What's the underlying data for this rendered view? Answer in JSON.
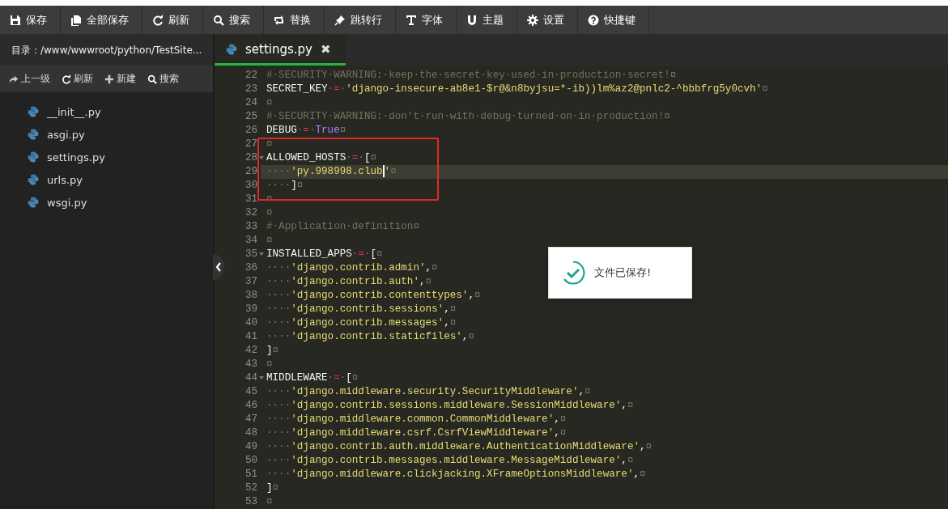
{
  "toolbar": [
    {
      "label": "保存"
    },
    {
      "label": "全部保存"
    },
    {
      "label": "刷新"
    },
    {
      "label": "搜索"
    },
    {
      "label": "替换"
    },
    {
      "label": "跳转行"
    },
    {
      "label": "字体"
    },
    {
      "label": "主题"
    },
    {
      "label": "设置"
    },
    {
      "label": "快捷键"
    }
  ],
  "sidebar": {
    "path": "目录：/www/wwwroot/python/TestSite...",
    "actions": [
      {
        "label": "上一级"
      },
      {
        "label": "刷新"
      },
      {
        "label": "新建"
      },
      {
        "label": "搜索"
      }
    ],
    "files": [
      {
        "name": "__init__.py"
      },
      {
        "name": "asgi.py"
      },
      {
        "name": "settings.py"
      },
      {
        "name": "urls.py"
      },
      {
        "name": "wsgi.py"
      }
    ]
  },
  "tabs": [
    {
      "label": "settings.py",
      "selected": true,
      "close": "✖"
    }
  ],
  "editor": {
    "lines": [
      {
        "number": "22",
        "foldable": false,
        "current": false,
        "tokens": [
          {
            "kind": "cm",
            "text": "#·SECURITY·WARNING:·keep·the·secret·key·used·in·production·secret!"
          },
          {
            "kind": "ws",
            "text": "¤"
          }
        ]
      },
      {
        "number": "23",
        "foldable": false,
        "current": false,
        "tokens": [
          {
            "kind": "nm",
            "text": "SECRET_KEY"
          },
          {
            "kind": "ws",
            "text": "·"
          },
          {
            "kind": "op",
            "text": "="
          },
          {
            "kind": "ws",
            "text": "·"
          },
          {
            "kind": "st",
            "text": "'django-insecure-ab8e1-$r@&n8byjsu=*-ib))lm%az2@pnlc2-^bbbfrg5y0cvh'"
          },
          {
            "kind": "ws",
            "text": "¤"
          }
        ]
      },
      {
        "number": "24",
        "foldable": false,
        "current": false,
        "tokens": [
          {
            "kind": "ws",
            "text": "¤"
          }
        ]
      },
      {
        "number": "25",
        "foldable": false,
        "current": false,
        "tokens": [
          {
            "kind": "cm",
            "text": "#·SECURITY·WARNING:·don't·run·with·debug·turned·on·in·production!"
          },
          {
            "kind": "ws",
            "text": "¤"
          }
        ]
      },
      {
        "number": "26",
        "foldable": false,
        "current": false,
        "tokens": [
          {
            "kind": "nm",
            "text": "DEBUG"
          },
          {
            "kind": "ws",
            "text": "·"
          },
          {
            "kind": "op",
            "text": "="
          },
          {
            "kind": "ws",
            "text": "·"
          },
          {
            "kind": "kw",
            "text": "True"
          },
          {
            "kind": "ws",
            "text": "¤"
          }
        ]
      },
      {
        "number": "27",
        "foldable": false,
        "current": false,
        "tokens": [
          {
            "kind": "ws",
            "text": "¤"
          }
        ]
      },
      {
        "number": "28",
        "foldable": true,
        "current": false,
        "tokens": [
          {
            "kind": "nm",
            "text": "ALLOWED_HOSTS"
          },
          {
            "kind": "ws",
            "text": "·"
          },
          {
            "kind": "op",
            "text": "="
          },
          {
            "kind": "ws",
            "text": "·"
          },
          {
            "kind": "nm",
            "text": "["
          },
          {
            "kind": "ws",
            "text": "¤"
          }
        ]
      },
      {
        "number": "29",
        "foldable": false,
        "current": true,
        "tokens": [
          {
            "kind": "ws",
            "text": "····"
          },
          {
            "kind": "st",
            "text": "'py.998998.club",
            "cursor_after": true
          },
          {
            "kind": "st",
            "text": "'"
          },
          {
            "kind": "ws",
            "text": "¤"
          }
        ]
      },
      {
        "number": "30",
        "foldable": false,
        "current": false,
        "tokens": [
          {
            "kind": "ws",
            "text": "····"
          },
          {
            "kind": "nm",
            "text": "]"
          },
          {
            "kind": "ws",
            "text": "¤"
          }
        ]
      },
      {
        "number": "31",
        "foldable": false,
        "current": false,
        "tokens": [
          {
            "kind": "ws",
            "text": "¤"
          }
        ]
      },
      {
        "number": "32",
        "foldable": false,
        "current": false,
        "tokens": [
          {
            "kind": "ws",
            "text": "¤"
          }
        ]
      },
      {
        "number": "33",
        "foldable": false,
        "current": false,
        "tokens": [
          {
            "kind": "cm",
            "text": "#·Application·definition"
          },
          {
            "kind": "ws",
            "text": "¤"
          }
        ]
      },
      {
        "number": "34",
        "foldable": false,
        "current": false,
        "tokens": [
          {
            "kind": "ws",
            "text": "¤"
          }
        ]
      },
      {
        "number": "35",
        "foldable": true,
        "current": false,
        "tokens": [
          {
            "kind": "nm",
            "text": "INSTALLED_APPS"
          },
          {
            "kind": "ws",
            "text": "·"
          },
          {
            "kind": "op",
            "text": "="
          },
          {
            "kind": "ws",
            "text": "·"
          },
          {
            "kind": "nm",
            "text": "["
          },
          {
            "kind": "ws",
            "text": "¤"
          }
        ]
      },
      {
        "number": "36",
        "foldable": false,
        "current": false,
        "tokens": [
          {
            "kind": "ws",
            "text": "····"
          },
          {
            "kind": "st",
            "text": "'django.contrib.admin'"
          },
          {
            "kind": "nm",
            "text": ","
          },
          {
            "kind": "ws",
            "text": "¤"
          }
        ]
      },
      {
        "number": "37",
        "foldable": false,
        "current": false,
        "tokens": [
          {
            "kind": "ws",
            "text": "····"
          },
          {
            "kind": "st",
            "text": "'django.contrib.auth'"
          },
          {
            "kind": "nm",
            "text": ","
          },
          {
            "kind": "ws",
            "text": "¤"
          }
        ]
      },
      {
        "number": "38",
        "foldable": false,
        "current": false,
        "tokens": [
          {
            "kind": "ws",
            "text": "····"
          },
          {
            "kind": "st",
            "text": "'django.contrib.contenttypes'"
          },
          {
            "kind": "nm",
            "text": ","
          },
          {
            "kind": "ws",
            "text": "¤"
          }
        ]
      },
      {
        "number": "39",
        "foldable": false,
        "current": false,
        "tokens": [
          {
            "kind": "ws",
            "text": "····"
          },
          {
            "kind": "st",
            "text": "'django.contrib.sessions'"
          },
          {
            "kind": "nm",
            "text": ","
          },
          {
            "kind": "ws",
            "text": "¤"
          }
        ]
      },
      {
        "number": "40",
        "foldable": false,
        "current": false,
        "tokens": [
          {
            "kind": "ws",
            "text": "····"
          },
          {
            "kind": "st",
            "text": "'django.contrib.messages'"
          },
          {
            "kind": "nm",
            "text": ","
          },
          {
            "kind": "ws",
            "text": "¤"
          }
        ]
      },
      {
        "number": "41",
        "foldable": false,
        "current": false,
        "tokens": [
          {
            "kind": "ws",
            "text": "····"
          },
          {
            "kind": "st",
            "text": "'django.contrib.staticfiles'"
          },
          {
            "kind": "nm",
            "text": ","
          },
          {
            "kind": "ws",
            "text": "¤"
          }
        ]
      },
      {
        "number": "42",
        "foldable": false,
        "current": false,
        "tokens": [
          {
            "kind": "nm",
            "text": "]"
          },
          {
            "kind": "ws",
            "text": "¤"
          }
        ]
      },
      {
        "number": "43",
        "foldable": false,
        "current": false,
        "tokens": [
          {
            "kind": "ws",
            "text": "¤"
          }
        ]
      },
      {
        "number": "44",
        "foldable": true,
        "current": false,
        "tokens": [
          {
            "kind": "nm",
            "text": "MIDDLEWARE"
          },
          {
            "kind": "ws",
            "text": "·"
          },
          {
            "kind": "op",
            "text": "="
          },
          {
            "kind": "ws",
            "text": "·"
          },
          {
            "kind": "nm",
            "text": "["
          },
          {
            "kind": "ws",
            "text": "¤"
          }
        ]
      },
      {
        "number": "45",
        "foldable": false,
        "current": false,
        "tokens": [
          {
            "kind": "ws",
            "text": "····"
          },
          {
            "kind": "st",
            "text": "'django.middleware.security.SecurityMiddleware'"
          },
          {
            "kind": "nm",
            "text": ","
          },
          {
            "kind": "ws",
            "text": "¤"
          }
        ]
      },
      {
        "number": "46",
        "foldable": false,
        "current": false,
        "tokens": [
          {
            "kind": "ws",
            "text": "····"
          },
          {
            "kind": "st",
            "text": "'django.contrib.sessions.middleware.SessionMiddleware'"
          },
          {
            "kind": "nm",
            "text": ","
          },
          {
            "kind": "ws",
            "text": "¤"
          }
        ]
      },
      {
        "number": "47",
        "foldable": false,
        "current": false,
        "tokens": [
          {
            "kind": "ws",
            "text": "····"
          },
          {
            "kind": "st",
            "text": "'django.middleware.common.CommonMiddleware'"
          },
          {
            "kind": "nm",
            "text": ","
          },
          {
            "kind": "ws",
            "text": "¤"
          }
        ]
      },
      {
        "number": "48",
        "foldable": false,
        "current": false,
        "tokens": [
          {
            "kind": "ws",
            "text": "····"
          },
          {
            "kind": "st",
            "text": "'django.middleware.csrf.CsrfViewMiddleware'"
          },
          {
            "kind": "nm",
            "text": ","
          },
          {
            "kind": "ws",
            "text": "¤"
          }
        ]
      },
      {
        "number": "49",
        "foldable": false,
        "current": false,
        "tokens": [
          {
            "kind": "ws",
            "text": "····"
          },
          {
            "kind": "st",
            "text": "'django.contrib.auth.middleware.AuthenticationMiddleware'"
          },
          {
            "kind": "nm",
            "text": ","
          },
          {
            "kind": "ws",
            "text": "¤"
          }
        ]
      },
      {
        "number": "50",
        "foldable": false,
        "current": false,
        "tokens": [
          {
            "kind": "ws",
            "text": "····"
          },
          {
            "kind": "st",
            "text": "'django.contrib.messages.middleware.MessageMiddleware'"
          },
          {
            "kind": "nm",
            "text": ","
          },
          {
            "kind": "ws",
            "text": "¤"
          }
        ]
      },
      {
        "number": "51",
        "foldable": false,
        "current": false,
        "tokens": [
          {
            "kind": "ws",
            "text": "····"
          },
          {
            "kind": "st",
            "text": "'django.middleware.clickjacking.XFrameOptionsMiddleware'"
          },
          {
            "kind": "nm",
            "text": ","
          },
          {
            "kind": "ws",
            "text": "¤"
          }
        ]
      },
      {
        "number": "52",
        "foldable": false,
        "current": false,
        "tokens": [
          {
            "kind": "nm",
            "text": "]"
          },
          {
            "kind": "ws",
            "text": "¤"
          }
        ]
      },
      {
        "number": "53",
        "foldable": false,
        "current": false,
        "tokens": [
          {
            "kind": "ws",
            "text": "¤"
          }
        ]
      }
    ]
  },
  "toast": {
    "message": "文件已保存!"
  }
}
